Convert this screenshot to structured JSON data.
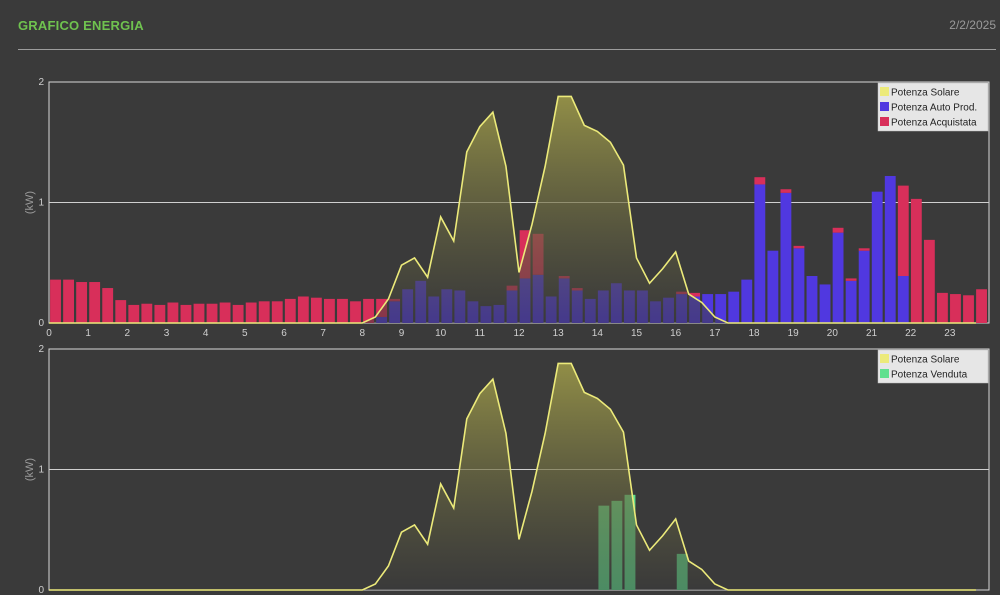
{
  "header": {
    "title": "GRAFICO ENERGIA",
    "date": "2/2/2025"
  },
  "colors": {
    "solar": "#ecea7a",
    "auto": "#5038e0",
    "bought": "#d82f5a",
    "sold": "#5fe08e",
    "grid": "#cfcfcf"
  },
  "chart_data": [
    {
      "type": "bar",
      "ylabel": "(kW)",
      "ylim": [
        0,
        2
      ],
      "yticks": [
        0,
        1,
        2
      ],
      "xlim": [
        0,
        24
      ],
      "xticks": [
        "0",
        "1",
        "2",
        "3",
        "4",
        "5",
        "6",
        "7",
        "8",
        "9",
        "10",
        "11",
        "12",
        "13",
        "14",
        "15",
        "16",
        "17",
        "18",
        "19",
        "20",
        "21",
        "22",
        "23"
      ],
      "grid": true,
      "legend_position": "top-right",
      "legend": [
        "Potenza Solare",
        "Potenza Auto Prod.",
        "Potenza Acquistata"
      ],
      "bar_interval_hours": 0.333,
      "series": [
        {
          "name": "Potenza Solare",
          "type": "area",
          "x": [
            0,
            0.333,
            0.667,
            1,
            1.333,
            1.667,
            2,
            2.333,
            2.667,
            3,
            3.333,
            3.667,
            4,
            4.333,
            4.667,
            5,
            5.333,
            5.667,
            6,
            6.333,
            6.667,
            7,
            7.333,
            7.667,
            8,
            8.333,
            8.667,
            9,
            9.333,
            9.667,
            10,
            10.333,
            10.667,
            11,
            11.333,
            11.667,
            12,
            12.333,
            12.667,
            13,
            13.333,
            13.667,
            14,
            14.333,
            14.667,
            15,
            15.333,
            15.667,
            16,
            16.333,
            16.667,
            17,
            17.333,
            17.667,
            18,
            18.333,
            18.667,
            19,
            19.333,
            19.667,
            20,
            20.333,
            20.667,
            21,
            21.333,
            21.667,
            22,
            22.333,
            22.667,
            23,
            23.333,
            23.667
          ],
          "values": [
            0,
            0,
            0,
            0,
            0,
            0,
            0,
            0,
            0,
            0,
            0,
            0,
            0,
            0,
            0,
            0,
            0,
            0,
            0,
            0,
            0,
            0,
            0,
            0,
            0,
            0.05,
            0.2,
            0.48,
            0.54,
            0.38,
            0.88,
            0.68,
            1.42,
            1.63,
            1.75,
            1.3,
            0.42,
            0.82,
            1.3,
            1.88,
            1.88,
            1.64,
            1.59,
            1.5,
            1.31,
            0.54,
            0.33,
            0.45,
            0.59,
            0.24,
            0.17,
            0.05,
            0,
            0,
            0,
            0,
            0,
            0,
            0,
            0,
            0,
            0,
            0,
            0,
            0,
            0,
            0,
            0,
            0,
            0,
            0,
            0
          ]
        },
        {
          "name": "Potenza Auto Prod.",
          "type": "bar",
          "values": [
            0,
            0,
            0,
            0,
            0,
            0,
            0,
            0,
            0,
            0,
            0,
            0,
            0,
            0,
            0,
            0,
            0,
            0,
            0,
            0,
            0,
            0,
            0,
            0,
            0,
            0.05,
            0.18,
            0.28,
            0.35,
            0.22,
            0.28,
            0.27,
            0.18,
            0.14,
            0.15,
            0.27,
            0.37,
            0.4,
            0.22,
            0.37,
            0.27,
            0.2,
            0.27,
            0.33,
            0.27,
            0.27,
            0.18,
            0.21,
            0.24,
            0.22,
            0.24,
            0.24,
            0.26,
            0.36,
            1.15,
            0.6,
            1.08,
            0.62,
            0.39,
            0.32,
            0.75,
            0.35,
            0.6,
            1.09,
            1.22,
            0.39,
            0,
            0,
            0,
            0,
            0,
            0
          ]
        },
        {
          "name": "Potenza Acquistata",
          "type": "bar",
          "values": [
            0.36,
            0.36,
            0.34,
            0.34,
            0.29,
            0.19,
            0.15,
            0.16,
            0.15,
            0.17,
            0.15,
            0.16,
            0.16,
            0.17,
            0.15,
            0.17,
            0.18,
            0.18,
            0.2,
            0.22,
            0.21,
            0.2,
            0.2,
            0.18,
            0.2,
            0.15,
            0.02,
            0,
            0,
            0,
            0,
            0,
            0,
            0,
            0,
            0.04,
            0.4,
            0.34,
            0,
            0.02,
            0.02,
            0,
            0,
            0,
            0,
            0,
            0,
            0,
            0.02,
            0.03,
            0,
            0,
            0,
            0,
            0.06,
            0,
            0.03,
            0.02,
            0,
            0,
            0.04,
            0.02,
            0.02,
            0,
            0,
            0.75,
            1.03,
            0.69,
            0.25,
            0.24,
            0.23,
            0.28
          ]
        }
      ]
    },
    {
      "type": "bar",
      "ylabel": "(kW)",
      "ylim": [
        0,
        2
      ],
      "yticks": [
        0,
        1,
        2
      ],
      "xlim": [
        0,
        24
      ],
      "grid": true,
      "legend_position": "top-right",
      "legend": [
        "Potenza Solare",
        "Potenza Venduta"
      ],
      "bar_interval_hours": 0.333,
      "series": [
        {
          "name": "Potenza Solare",
          "type": "area",
          "x": [
            0,
            0.333,
            0.667,
            1,
            1.333,
            1.667,
            2,
            2.333,
            2.667,
            3,
            3.333,
            3.667,
            4,
            4.333,
            4.667,
            5,
            5.333,
            5.667,
            6,
            6.333,
            6.667,
            7,
            7.333,
            7.667,
            8,
            8.333,
            8.667,
            9,
            9.333,
            9.667,
            10,
            10.333,
            10.667,
            11,
            11.333,
            11.667,
            12,
            12.333,
            12.667,
            13,
            13.333,
            13.667,
            14,
            14.333,
            14.667,
            15,
            15.333,
            15.667,
            16,
            16.333,
            16.667,
            17,
            17.333,
            17.667,
            18,
            18.333,
            18.667,
            19,
            19.333,
            19.667,
            20,
            20.333,
            20.667,
            21,
            21.333,
            21.667,
            22,
            22.333,
            22.667,
            23,
            23.333,
            23.667
          ],
          "values": [
            0,
            0,
            0,
            0,
            0,
            0,
            0,
            0,
            0,
            0,
            0,
            0,
            0,
            0,
            0,
            0,
            0,
            0,
            0,
            0,
            0,
            0,
            0,
            0,
            0,
            0.05,
            0.2,
            0.48,
            0.54,
            0.38,
            0.88,
            0.68,
            1.42,
            1.63,
            1.75,
            1.3,
            0.42,
            0.82,
            1.3,
            1.88,
            1.88,
            1.64,
            1.59,
            1.5,
            1.31,
            0.54,
            0.33,
            0.45,
            0.59,
            0.24,
            0.17,
            0.05,
            0,
            0,
            0,
            0,
            0,
            0,
            0,
            0,
            0,
            0,
            0,
            0,
            0,
            0,
            0,
            0,
            0,
            0,
            0,
            0
          ]
        },
        {
          "name": "Potenza Venduta",
          "type": "bar",
          "values": [
            0,
            0,
            0,
            0,
            0,
            0,
            0,
            0,
            0,
            0,
            0,
            0,
            0,
            0,
            0,
            0,
            0,
            0,
            0,
            0,
            0,
            0,
            0,
            0,
            0,
            0,
            0,
            0,
            0,
            0,
            0,
            0,
            0,
            0,
            0,
            0,
            0,
            0,
            0,
            0,
            0,
            0,
            0,
            0,
            0,
            0,
            0,
            0,
            0,
            0,
            0,
            0,
            0,
            0,
            0,
            0,
            0,
            0,
            0,
            0,
            0,
            0,
            0,
            0,
            0,
            0,
            0,
            0,
            0,
            0,
            0,
            0,
            0
          ],
          "points": [
            {
              "x": 14.0,
              "y": 0.7
            },
            {
              "x": 14.333,
              "y": 0.74
            },
            {
              "x": 14.667,
              "y": 0.79
            },
            {
              "x": 16.0,
              "y": 0.3
            }
          ]
        }
      ]
    }
  ]
}
